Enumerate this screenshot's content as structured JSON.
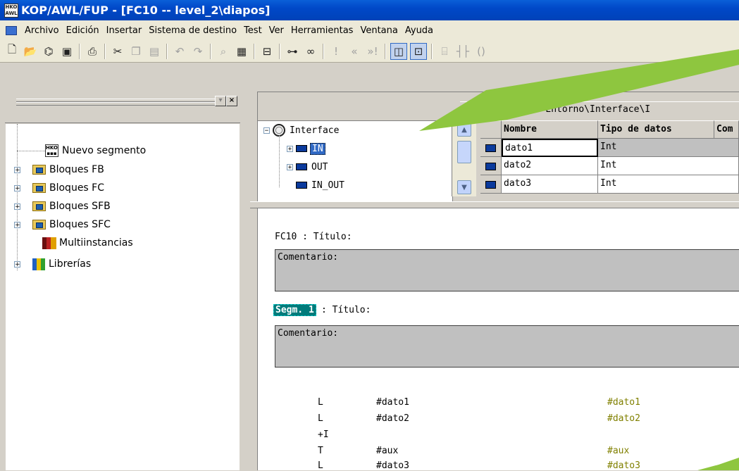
{
  "window": {
    "title": "KOP/AWL/FUP  - [FC10 -- level_2\\diapos]"
  },
  "menu": [
    "Archivo",
    "Edición",
    "Insertar",
    "Sistema de destino",
    "Test",
    "Ver",
    "Herramientas",
    "Ventana",
    "Ayuda"
  ],
  "toolbar": {
    "icons": [
      "new-icon",
      "open-icon",
      "network-icon",
      "save-icon",
      "print-icon",
      "cut-icon",
      "copy-icon",
      "paste-icon",
      "undo-icon",
      "redo-icon",
      "find-icon",
      "compile-icon",
      "segment-icon",
      "accessible-nodes-icon",
      "monitor-icon",
      "breakpoint-icon",
      "prev-icon",
      "next-icon",
      "overview-icon",
      "details-icon",
      "new-segment-icon"
    ]
  },
  "catalog": {
    "items": [
      {
        "label": "Nuevo segmento",
        "expandable": false,
        "icon": "new-network-icon"
      },
      {
        "label": "Bloques FB",
        "expandable": true,
        "icon": "block-folder-icon"
      },
      {
        "label": "Bloques FC",
        "expandable": true,
        "icon": "block-folder-icon"
      },
      {
        "label": "Bloques SFB",
        "expandable": true,
        "icon": "block-folder-icon"
      },
      {
        "label": "Bloques SFC",
        "expandable": true,
        "icon": "block-folder-icon"
      },
      {
        "label": "Multiinstancias",
        "expandable": false,
        "icon": "multiinstance-icon"
      },
      {
        "label": "Librerías",
        "expandable": true,
        "icon": "library-icon"
      }
    ]
  },
  "interface": {
    "content_label": "Contenido de:  'Entorno\\Interface\\I",
    "tree": {
      "root": "Interface",
      "children": [
        "IN",
        "OUT",
        "IN_OUT"
      ]
    },
    "columns": [
      "Nombre",
      "Tipo de datos",
      "Com"
    ],
    "rows": [
      {
        "name": "dato1",
        "type": "Int"
      },
      {
        "name": "dato2",
        "type": "Int"
      },
      {
        "name": "dato3",
        "type": "Int"
      }
    ]
  },
  "editor": {
    "block_title": "FC10 : Título:",
    "block_comment": "Comentario:",
    "segment_badge": "Segm.  1",
    "segment_title": ": Título:",
    "segment_comment": "Comentario:",
    "code": [
      {
        "op": "L",
        "operand": "#dato1",
        "symbol": "#dato1"
      },
      {
        "op": "L",
        "operand": "#dato2",
        "symbol": "#dato2"
      },
      {
        "op": "+I",
        "operand": "",
        "symbol": ""
      },
      {
        "op": "T",
        "operand": "#aux",
        "symbol": "#aux"
      },
      {
        "op": "L",
        "operand": "#dato3",
        "symbol": "#dato3"
      }
    ]
  },
  "colors": {
    "arrow": "#8ec63f",
    "title_bar": "#0a5fd8",
    "segment_badge": "#007b7b",
    "symbol": "#808000"
  }
}
